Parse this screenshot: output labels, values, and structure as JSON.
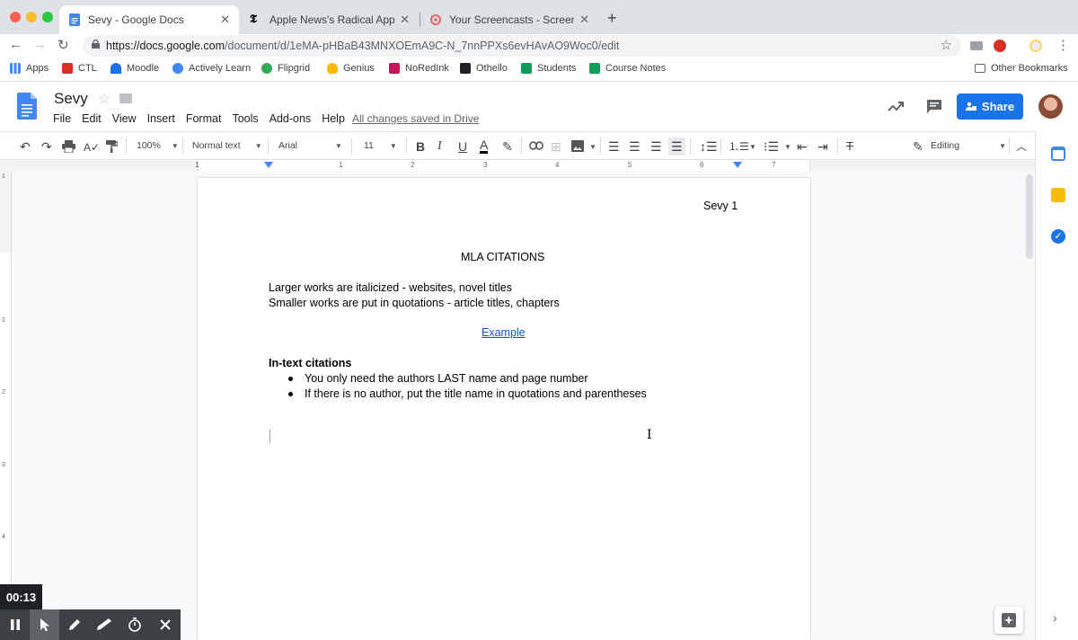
{
  "browser": {
    "tabs": [
      {
        "title": "Sevy - Google Docs",
        "active": true
      },
      {
        "title": "Apple News's Radical Approac",
        "active": false
      },
      {
        "title": "Your Screencasts - Screencast",
        "active": false
      }
    ],
    "url_host": "https://docs.google.com",
    "url_path": "/document/d/1eMA-pHBaB43MNXOEmA9C-N_7nnPPXs6evHAvAO9Woc0/edit",
    "bookmarks": [
      "Apps",
      "CTL",
      "Moodle",
      "Actively Learn",
      "Flipgrid",
      "Genius",
      "NoRedInk",
      "Othello",
      "Students",
      "Course Notes"
    ],
    "other_bookmarks": "Other Bookmarks"
  },
  "docs": {
    "title": "Sevy",
    "menus": [
      "File",
      "Edit",
      "View",
      "Insert",
      "Format",
      "Tools",
      "Add-ons",
      "Help"
    ],
    "save_status": "All changes saved in Drive",
    "share_label": "Share",
    "toolbar": {
      "zoom": "100%",
      "style": "Normal text",
      "font": "Arial",
      "size": "11",
      "mode": "Editing"
    },
    "ruler_numbers": [
      "1",
      "1",
      "2",
      "3",
      "4",
      "5",
      "6",
      "7"
    ],
    "vruler_numbers": [
      "1",
      "1",
      "2",
      "3",
      "4"
    ]
  },
  "document": {
    "header": "Sevy 1",
    "heading": "MLA CITATIONS",
    "line1": "Larger works are italicized - websites, novel titles",
    "line2": "Smaller works are put in quotations - article titles, chapters",
    "link": "Example",
    "subheading": "In-text citations",
    "bullets": [
      "You only need the authors LAST name and page number",
      "If there is no author, put the title name in quotations and parentheses"
    ]
  },
  "recorder": {
    "elapsed": "00:13"
  },
  "colors": {
    "accent": "#1a73e8",
    "link": "#1155cc",
    "docs_blue": "#4285f4"
  }
}
